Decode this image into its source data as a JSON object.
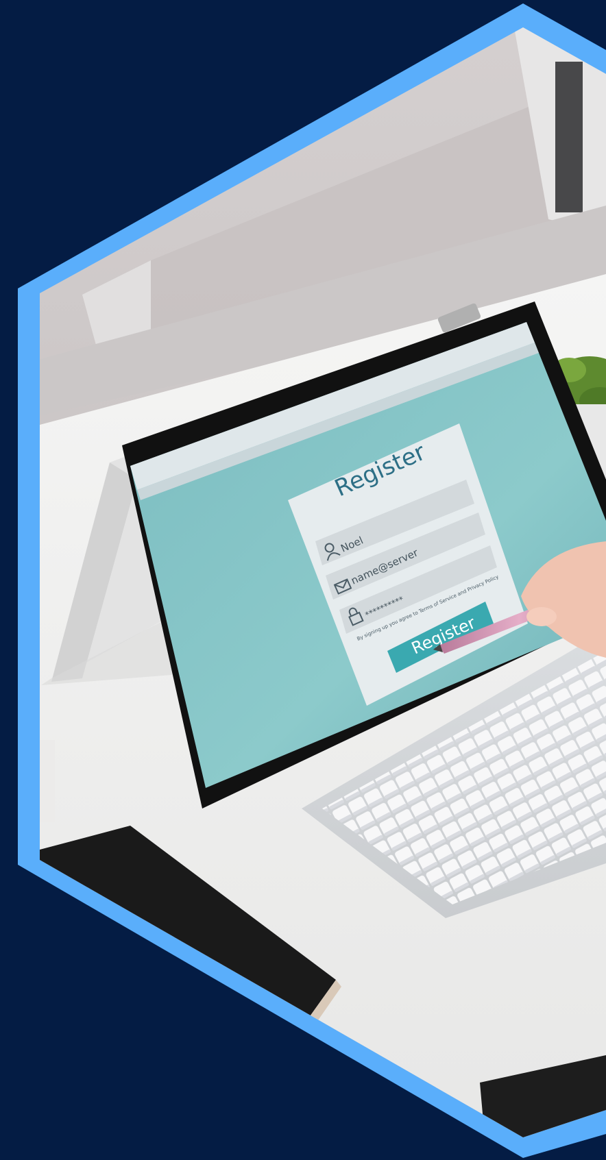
{
  "colors": {
    "background": "#041c44",
    "frame": "#5aaefb",
    "screen": "#8cc6c8",
    "card": "#e6ecee",
    "accent": "#3aa9b0",
    "heading": "#2d6f86"
  },
  "register_form": {
    "title": "Register",
    "name_value": "Noel",
    "email_value": "name@server",
    "password_value": "**********",
    "terms_text": "By signing up you agree to Terms of Service and Privacy Policy",
    "submit_label": "Register"
  },
  "icons": {
    "name": "user-icon",
    "email": "envelope-icon",
    "password": "lock-icon"
  }
}
